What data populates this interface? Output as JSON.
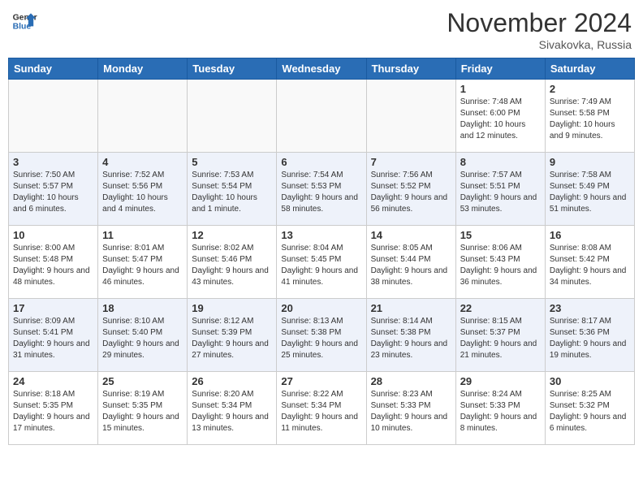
{
  "header": {
    "logo_line1": "General",
    "logo_line2": "Blue",
    "month_title": "November 2024",
    "location": "Sivakovka, Russia"
  },
  "weekdays": [
    "Sunday",
    "Monday",
    "Tuesday",
    "Wednesday",
    "Thursday",
    "Friday",
    "Saturday"
  ],
  "weeks": [
    [
      {
        "day": "",
        "info": ""
      },
      {
        "day": "",
        "info": ""
      },
      {
        "day": "",
        "info": ""
      },
      {
        "day": "",
        "info": ""
      },
      {
        "day": "",
        "info": ""
      },
      {
        "day": "1",
        "info": "Sunrise: 7:48 AM\nSunset: 6:00 PM\nDaylight: 10 hours and 12 minutes."
      },
      {
        "day": "2",
        "info": "Sunrise: 7:49 AM\nSunset: 5:58 PM\nDaylight: 10 hours and 9 minutes."
      }
    ],
    [
      {
        "day": "3",
        "info": "Sunrise: 7:50 AM\nSunset: 5:57 PM\nDaylight: 10 hours and 6 minutes."
      },
      {
        "day": "4",
        "info": "Sunrise: 7:52 AM\nSunset: 5:56 PM\nDaylight: 10 hours and 4 minutes."
      },
      {
        "day": "5",
        "info": "Sunrise: 7:53 AM\nSunset: 5:54 PM\nDaylight: 10 hours and 1 minute."
      },
      {
        "day": "6",
        "info": "Sunrise: 7:54 AM\nSunset: 5:53 PM\nDaylight: 9 hours and 58 minutes."
      },
      {
        "day": "7",
        "info": "Sunrise: 7:56 AM\nSunset: 5:52 PM\nDaylight: 9 hours and 56 minutes."
      },
      {
        "day": "8",
        "info": "Sunrise: 7:57 AM\nSunset: 5:51 PM\nDaylight: 9 hours and 53 minutes."
      },
      {
        "day": "9",
        "info": "Sunrise: 7:58 AM\nSunset: 5:49 PM\nDaylight: 9 hours and 51 minutes."
      }
    ],
    [
      {
        "day": "10",
        "info": "Sunrise: 8:00 AM\nSunset: 5:48 PM\nDaylight: 9 hours and 48 minutes."
      },
      {
        "day": "11",
        "info": "Sunrise: 8:01 AM\nSunset: 5:47 PM\nDaylight: 9 hours and 46 minutes."
      },
      {
        "day": "12",
        "info": "Sunrise: 8:02 AM\nSunset: 5:46 PM\nDaylight: 9 hours and 43 minutes."
      },
      {
        "day": "13",
        "info": "Sunrise: 8:04 AM\nSunset: 5:45 PM\nDaylight: 9 hours and 41 minutes."
      },
      {
        "day": "14",
        "info": "Sunrise: 8:05 AM\nSunset: 5:44 PM\nDaylight: 9 hours and 38 minutes."
      },
      {
        "day": "15",
        "info": "Sunrise: 8:06 AM\nSunset: 5:43 PM\nDaylight: 9 hours and 36 minutes."
      },
      {
        "day": "16",
        "info": "Sunrise: 8:08 AM\nSunset: 5:42 PM\nDaylight: 9 hours and 34 minutes."
      }
    ],
    [
      {
        "day": "17",
        "info": "Sunrise: 8:09 AM\nSunset: 5:41 PM\nDaylight: 9 hours and 31 minutes."
      },
      {
        "day": "18",
        "info": "Sunrise: 8:10 AM\nSunset: 5:40 PM\nDaylight: 9 hours and 29 minutes."
      },
      {
        "day": "19",
        "info": "Sunrise: 8:12 AM\nSunset: 5:39 PM\nDaylight: 9 hours and 27 minutes."
      },
      {
        "day": "20",
        "info": "Sunrise: 8:13 AM\nSunset: 5:38 PM\nDaylight: 9 hours and 25 minutes."
      },
      {
        "day": "21",
        "info": "Sunrise: 8:14 AM\nSunset: 5:38 PM\nDaylight: 9 hours and 23 minutes."
      },
      {
        "day": "22",
        "info": "Sunrise: 8:15 AM\nSunset: 5:37 PM\nDaylight: 9 hours and 21 minutes."
      },
      {
        "day": "23",
        "info": "Sunrise: 8:17 AM\nSunset: 5:36 PM\nDaylight: 9 hours and 19 minutes."
      }
    ],
    [
      {
        "day": "24",
        "info": "Sunrise: 8:18 AM\nSunset: 5:35 PM\nDaylight: 9 hours and 17 minutes."
      },
      {
        "day": "25",
        "info": "Sunrise: 8:19 AM\nSunset: 5:35 PM\nDaylight: 9 hours and 15 minutes."
      },
      {
        "day": "26",
        "info": "Sunrise: 8:20 AM\nSunset: 5:34 PM\nDaylight: 9 hours and 13 minutes."
      },
      {
        "day": "27",
        "info": "Sunrise: 8:22 AM\nSunset: 5:34 PM\nDaylight: 9 hours and 11 minutes."
      },
      {
        "day": "28",
        "info": "Sunrise: 8:23 AM\nSunset: 5:33 PM\nDaylight: 9 hours and 10 minutes."
      },
      {
        "day": "29",
        "info": "Sunrise: 8:24 AM\nSunset: 5:33 PM\nDaylight: 9 hours and 8 minutes."
      },
      {
        "day": "30",
        "info": "Sunrise: 8:25 AM\nSunset: 5:32 PM\nDaylight: 9 hours and 6 minutes."
      }
    ]
  ]
}
